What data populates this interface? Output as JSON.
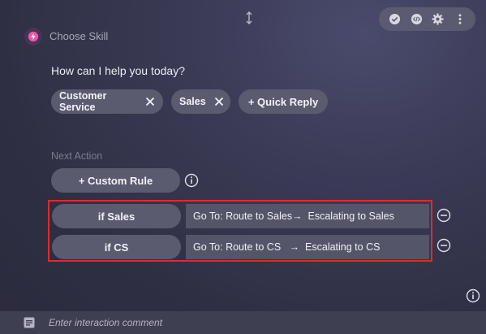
{
  "header": {
    "choose_skill": "Choose Skill"
  },
  "toolbar": {
    "icons": [
      "check-circle-icon",
      "code-icon",
      "gear-icon",
      "more-vertical-icon"
    ]
  },
  "prompt": "How can I help you today?",
  "chips": [
    {
      "label": "Customer Service"
    },
    {
      "label": "Sales"
    }
  ],
  "quick_reply_label": "+ Quick Reply",
  "next_action_label": "Next Action",
  "custom_rule_label": "+ Custom Rule",
  "rules": [
    {
      "condition": "if Sales",
      "action": "Go To: Route to Sales→  Escalating to Sales"
    },
    {
      "condition": "if CS",
      "action": "Go To: Route to CS   →  Escalating to CS"
    }
  ],
  "comment": {
    "placeholder": "Enter interaction comment",
    "value": ""
  },
  "colors": {
    "highlight_border": "#e02b2b",
    "skill_accent": "#e85aa8"
  }
}
